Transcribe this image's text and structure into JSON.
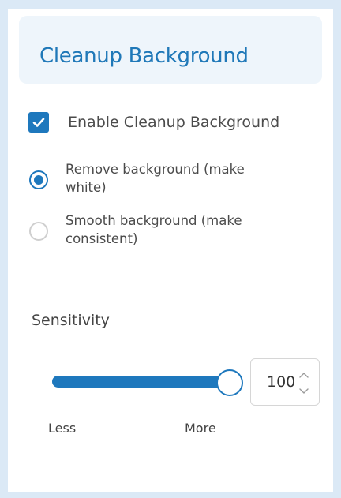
{
  "header": {
    "title": "Cleanup Background"
  },
  "cleanup": {
    "enable_label": "Enable Cleanup Background",
    "enabled": true,
    "options": [
      {
        "label": "Remove background (make white)",
        "selected": true
      },
      {
        "label": "Smooth background (make consistent)",
        "selected": false
      }
    ]
  },
  "sensitivity": {
    "label": "Sensitivity",
    "value": "100",
    "level": 1.0,
    "min_label": "Less",
    "max_label": "More"
  },
  "colors": {
    "accent": "#1e78bd",
    "header_bg": "#eef5fb",
    "page_bg": "#dbe9f6"
  },
  "icons": {
    "checkbox": "checkmark-icon",
    "stepper_up": "chevron-up-icon",
    "stepper_down": "chevron-down-icon"
  }
}
